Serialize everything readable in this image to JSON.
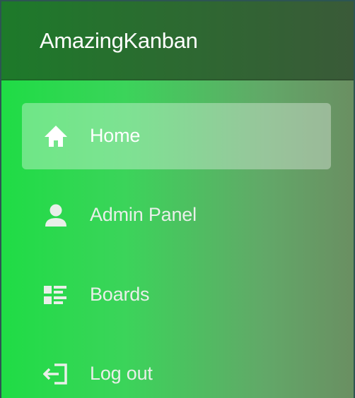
{
  "app": {
    "title": "AmazingKanban"
  },
  "sidebar": {
    "items": [
      {
        "label": "Home",
        "icon": "home-icon",
        "active": true
      },
      {
        "label": "Admin Panel",
        "icon": "user-icon",
        "active": false
      },
      {
        "label": "Boards",
        "icon": "boards-icon",
        "active": false
      },
      {
        "label": "Log out",
        "icon": "logout-icon",
        "active": false
      }
    ]
  },
  "colors": {
    "page_border": "#2d5552",
    "brand_bar": "#1d7a2a",
    "sidebar_green": "#1fdc45",
    "sidebar_fade": "#6a8f62",
    "active_item": "rgba(255,255,255,0.34)",
    "text": "#ffffff"
  }
}
